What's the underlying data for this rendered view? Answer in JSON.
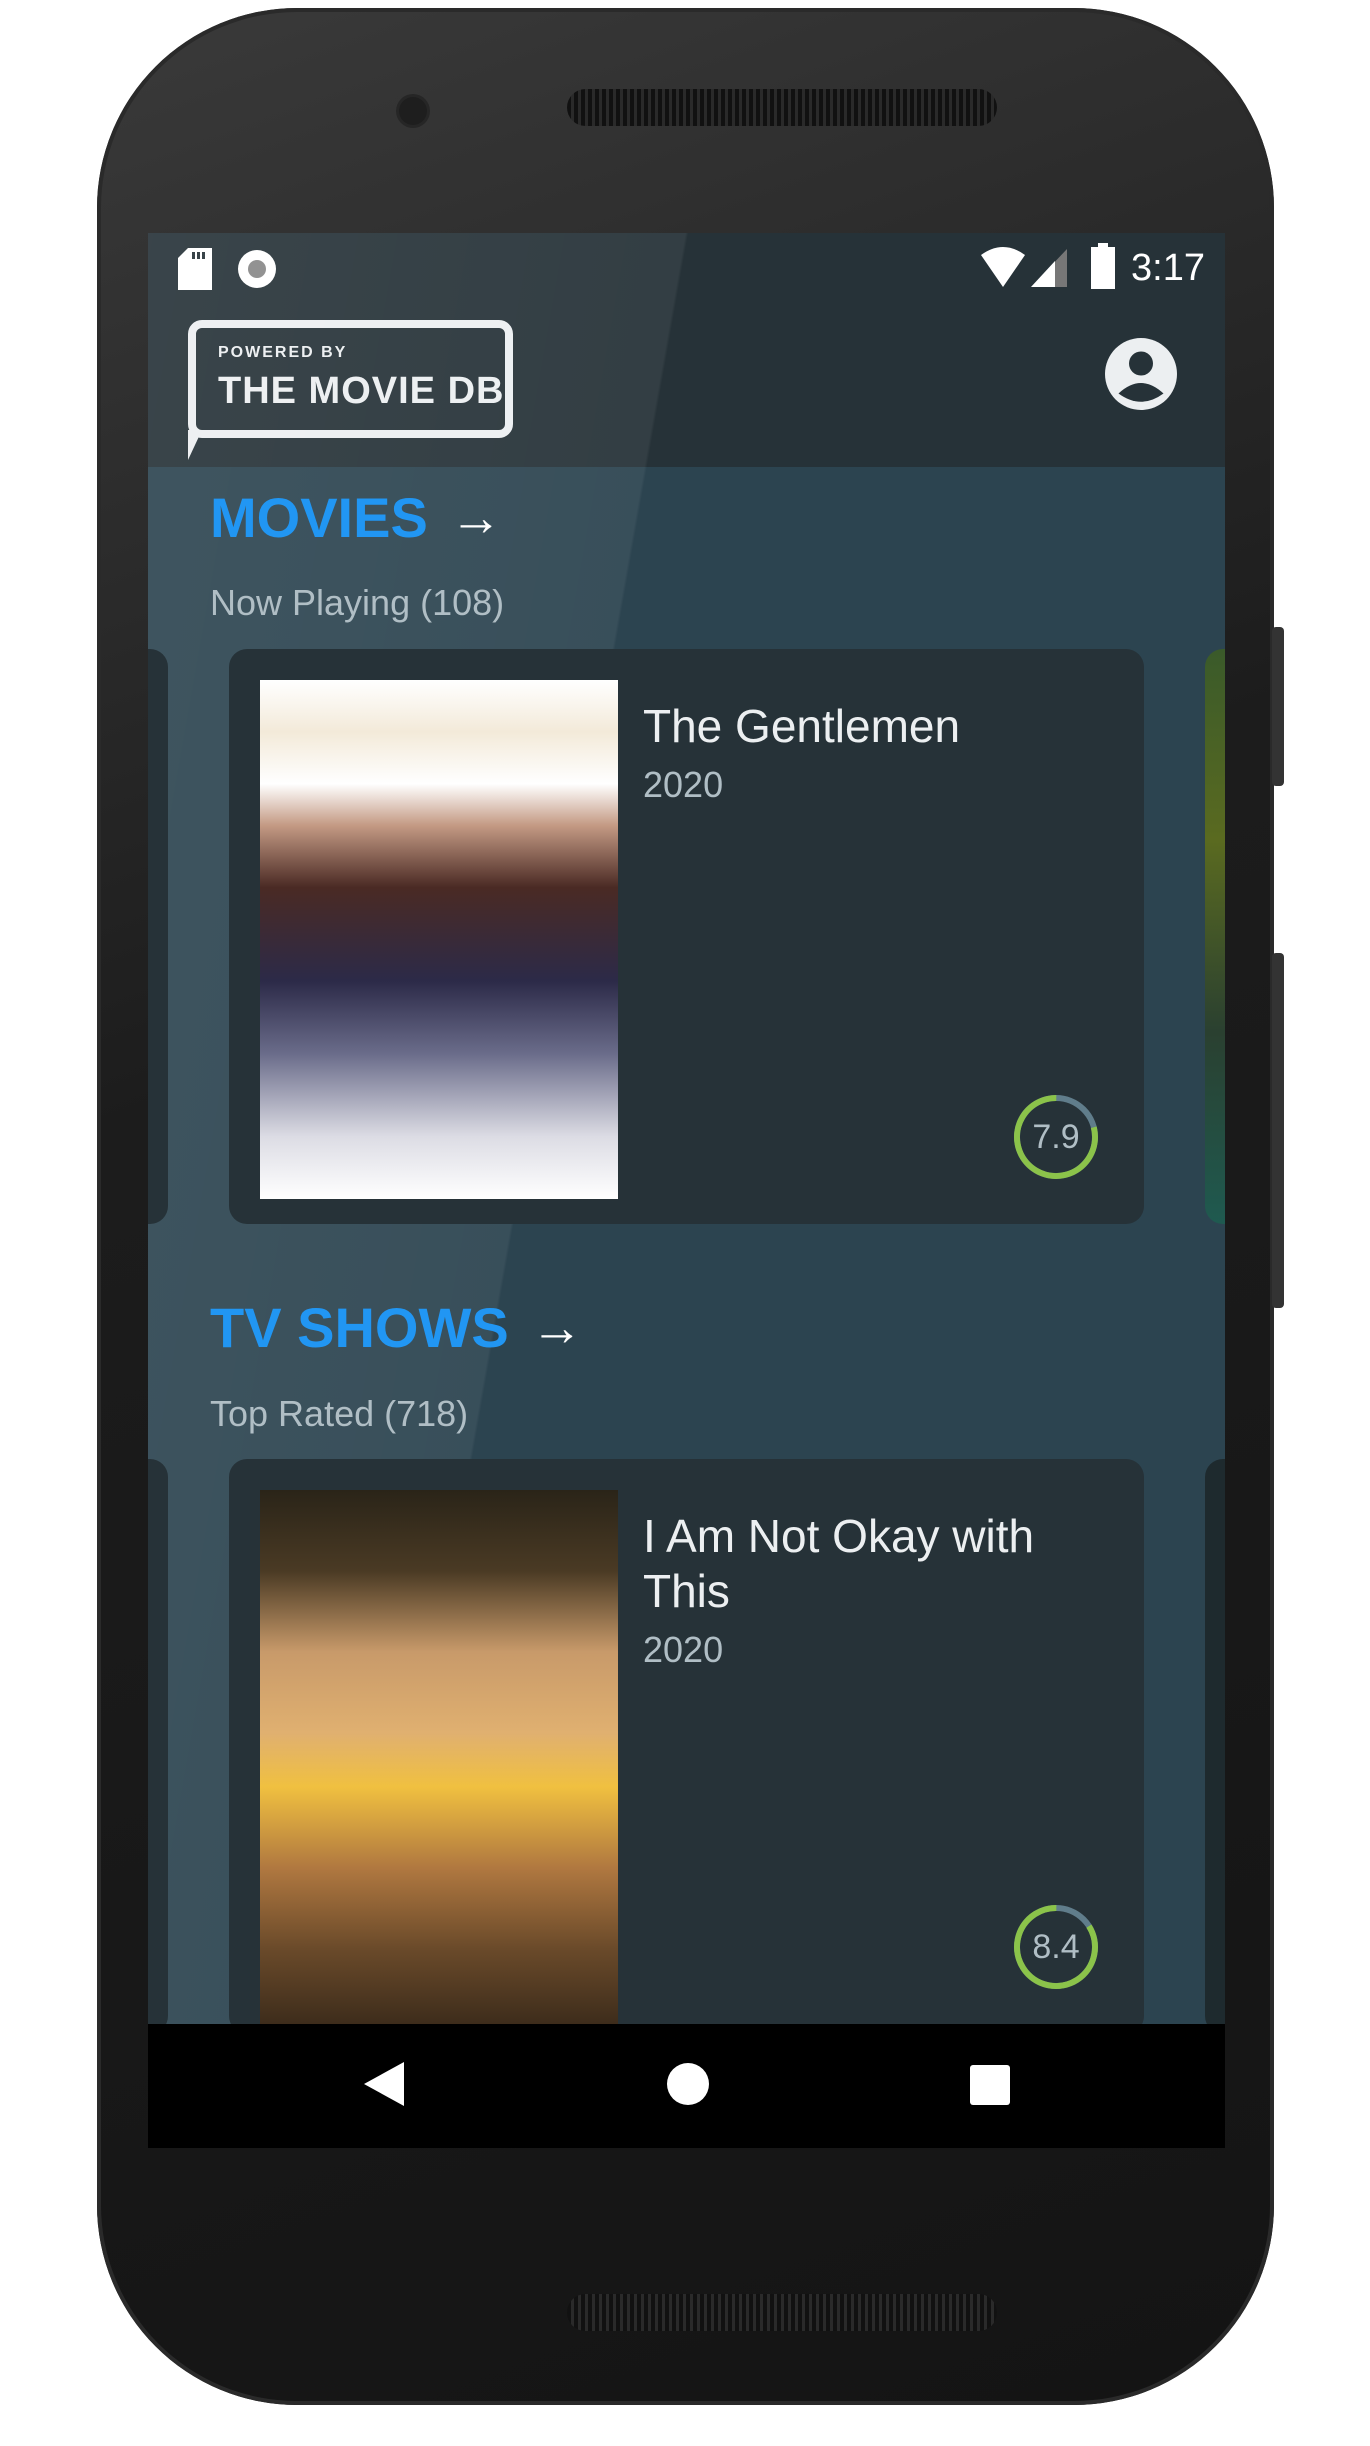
{
  "status_bar": {
    "time": "3:17",
    "icons": [
      "sd-card-icon",
      "sync-icon",
      "wifi-icon",
      "signal-icon",
      "battery-icon"
    ]
  },
  "toolbar": {
    "logo_powered": "POWERED BY",
    "logo_name": "THE MOVIE DB",
    "account_icon": "account-circle-icon"
  },
  "sections": [
    {
      "title": "MOVIES",
      "subtitle": "Now Playing (108)",
      "card": {
        "title": "The Gentlemen",
        "year": "2020",
        "rating": "7.9",
        "rating_value": 7.9
      }
    },
    {
      "title": "TV SHOWS",
      "subtitle": "Top Rated (718)",
      "card": {
        "title": "I Am Not Okay with This",
        "year": "2020",
        "rating": "8.4",
        "rating_value": 8.4
      }
    }
  ],
  "colors": {
    "accent": "#2196f3",
    "rating_ring": "#8bc34a",
    "card": "#263238",
    "background": "#2c4450"
  },
  "nav": {
    "back": "back-icon",
    "home": "home-icon",
    "recents": "recents-icon"
  }
}
